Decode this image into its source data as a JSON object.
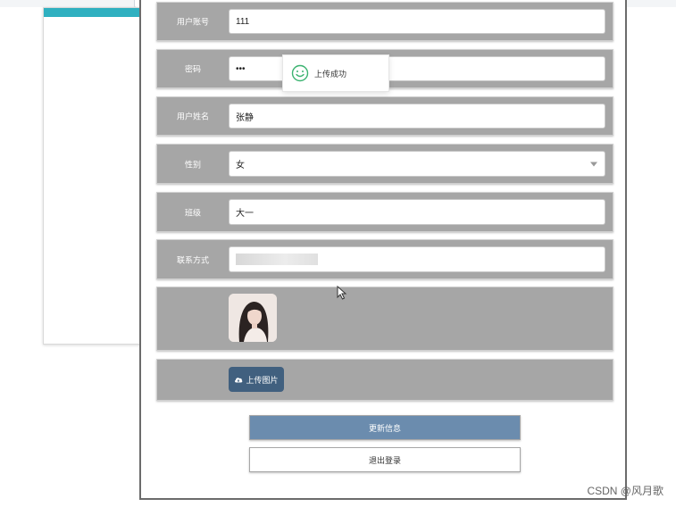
{
  "form": {
    "account_label": "用户账号",
    "account_value": "111",
    "password_label": "密码",
    "password_value": "•••",
    "name_label": "用户姓名",
    "name_value": "张静",
    "gender_label": "性别",
    "gender_value": "女",
    "class_label": "班级",
    "class_value": "大一",
    "contact_label": "联系方式",
    "upload_label": "上传图片",
    "update_label": "更新信息",
    "logout_label": "退出登录"
  },
  "toast": {
    "message": "上传成功"
  },
  "watermark": "CSDN @风月歌",
  "colors": {
    "row_bg": "#a6a6a6",
    "upload_button": "#41607f",
    "update_button": "#6b8cae",
    "toast_icon": "#3cb371"
  }
}
